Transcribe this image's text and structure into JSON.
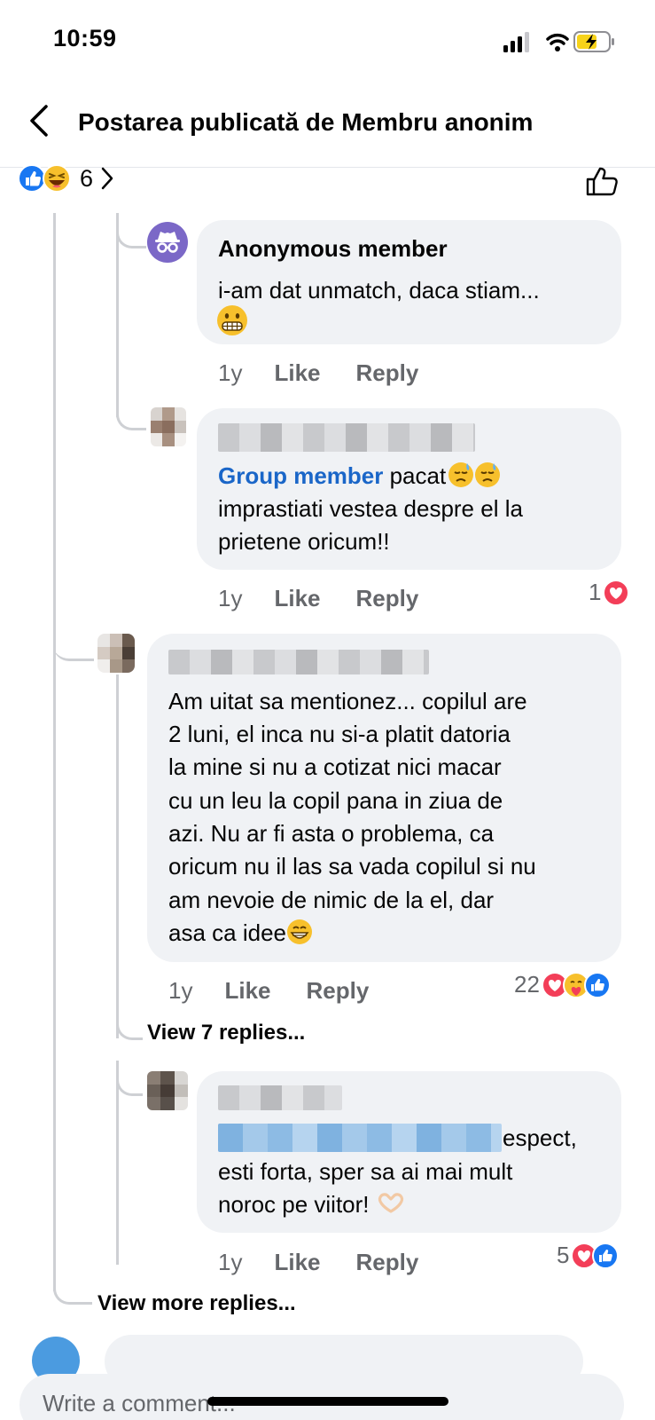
{
  "status_bar": {
    "time": "10:59"
  },
  "header": {
    "title": "Postarea publicată de Membru anonim"
  },
  "post_reactions": {
    "count": "6"
  },
  "comments": [
    {
      "author": "Anonymous member",
      "text": "i-am dat unmatch, daca stiam...",
      "age": "1y",
      "like": "Like",
      "reply": "Reply"
    },
    {
      "mention": "Group member",
      "text_line1": " pacat",
      "text_line2": "imprastiati vestea despre el la",
      "text_line3": "prietene oricum!!",
      "age": "1y",
      "like": "Like",
      "reply": "Reply",
      "reaction_count": "1"
    },
    {
      "lines": [
        "Am uitat sa mentionez... copilul are",
        "2 luni, el inca nu si-a platit datoria",
        "la mine si nu a cotizat nici macar",
        "cu un leu la copil pana in ziua de",
        "azi. Nu ar fi asta o problema, ca",
        "oricum nu il las sa vada copilul si nu",
        "am nevoie de nimic de la el, dar",
        "asa ca idee"
      ],
      "age": "1y",
      "like": "Like",
      "reply": "Reply",
      "reaction_count": "22"
    },
    {
      "text_line1": "espect,",
      "text_line2": "esti forta, sper sa ai mai mult",
      "text_line3": "noroc pe viitor!",
      "age": "1y",
      "like": "Like",
      "reply": "Reply",
      "reaction_count": "5"
    }
  ],
  "view_replies": "View 7 replies...",
  "view_more_replies": "View more replies...",
  "composer": {
    "placeholder": "Write a comment..."
  },
  "colors": {
    "accent": "#1a66c8",
    "like_blue": "#1877f2",
    "love_red": "#f33e58",
    "bubble": "#f0f2f5",
    "muted": "#65676b",
    "anon_avatar": "#7b68c7"
  }
}
